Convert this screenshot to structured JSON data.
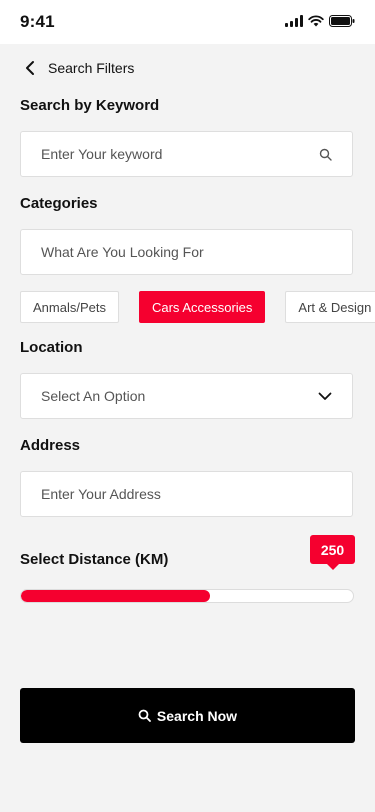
{
  "status_bar": {
    "time": "9:41"
  },
  "header": {
    "title": "Search Filters"
  },
  "keyword": {
    "label": "Search by Keyword",
    "placeholder": "Enter Your keyword"
  },
  "categories": {
    "label": "Categories",
    "placeholder": "What Are You Looking For",
    "chips": [
      "Anmals/Pets",
      "Cars Accessories",
      "Art & Design"
    ],
    "active_chip": "Cars Accessories"
  },
  "location": {
    "label": "Location",
    "selected": "Select An Option"
  },
  "address": {
    "label": "Address",
    "placeholder": "Enter Your Address"
  },
  "distance": {
    "label": "Select Distance (KM)",
    "value": "250",
    "fill_fraction": 0.57
  },
  "search_button": {
    "label": "Search Now"
  },
  "colors": {
    "accent": "#f5002f",
    "button": "#000000",
    "background": "#f3f3f3"
  },
  "icons": [
    "back-chevron-icon",
    "search-icon",
    "chevron-down-icon"
  ]
}
